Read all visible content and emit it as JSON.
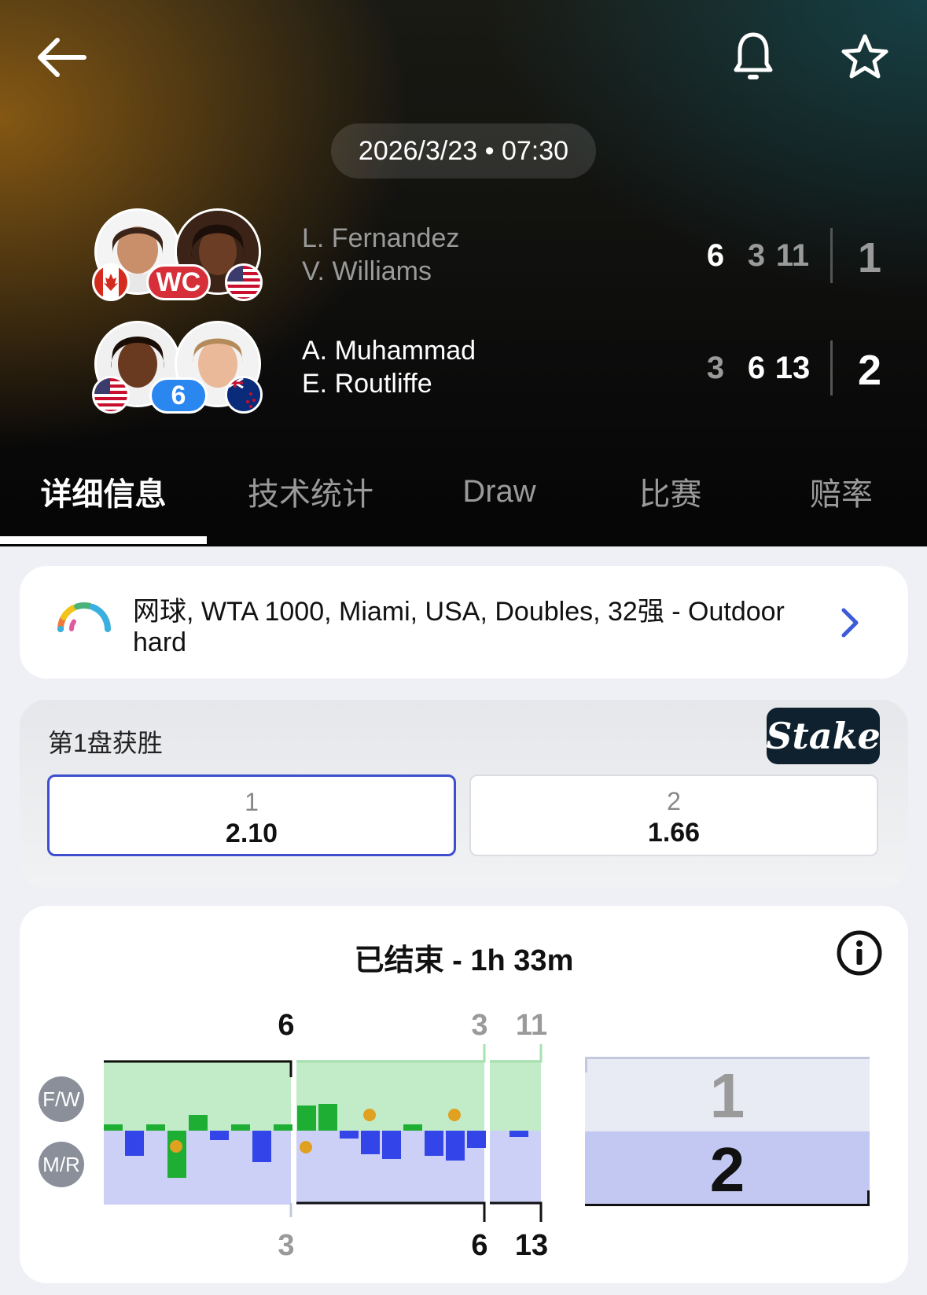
{
  "header": {
    "date_time": "2026/3/23 • 07:30",
    "back_icon": "arrow-left-icon",
    "bell_icon": "bell-icon",
    "star_icon": "star-icon"
  },
  "teams": [
    {
      "player1": "L. Fernandez",
      "player2": "V. Williams",
      "badge": "WC",
      "flag1": "canada",
      "flag2": "usa",
      "set_scores": [
        "6",
        "3",
        "11"
      ],
      "sets_won": "1",
      "winner": false
    },
    {
      "player1": "A. Muhammad",
      "player2": "E. Routliffe",
      "badge": "6",
      "flag1": "usa",
      "flag2": "new-zealand",
      "set_scores": [
        "3",
        "6",
        "13"
      ],
      "sets_won": "2",
      "winner": true
    }
  ],
  "tabs": [
    {
      "label": "详细信息",
      "active": true
    },
    {
      "label": "技术统计",
      "active": false
    },
    {
      "label": "Draw",
      "active": false
    },
    {
      "label": "比赛",
      "active": false
    },
    {
      "label": "赔率",
      "active": false
    }
  ],
  "tournament": {
    "line1": "网球, WTA 1000, Miami, USA, Doubles, 32强 - Outdoor",
    "line2": "hard"
  },
  "odds": {
    "title": "第1盘获胜",
    "brand": "Stake",
    "options": [
      {
        "label": "1",
        "value": "2.10",
        "selected": true
      },
      {
        "label": "2",
        "value": "1.66",
        "selected": false
      }
    ]
  },
  "momentum": {
    "status": "已结束 - 1h 33m",
    "team1_chip": "F/W",
    "team2_chip": "M/R",
    "top_scores": [
      "6",
      "3",
      "11"
    ],
    "bottom_scores": [
      "3",
      "6",
      "13"
    ],
    "sets_won_team1": "1",
    "sets_won_team2": "2",
    "colors": {
      "team1": "#1fae34",
      "team2": "#3345e8",
      "team1_bg": "#c2ecc8",
      "team2_bg": "#ccd0f6",
      "ball": "#e0a020"
    }
  }
}
